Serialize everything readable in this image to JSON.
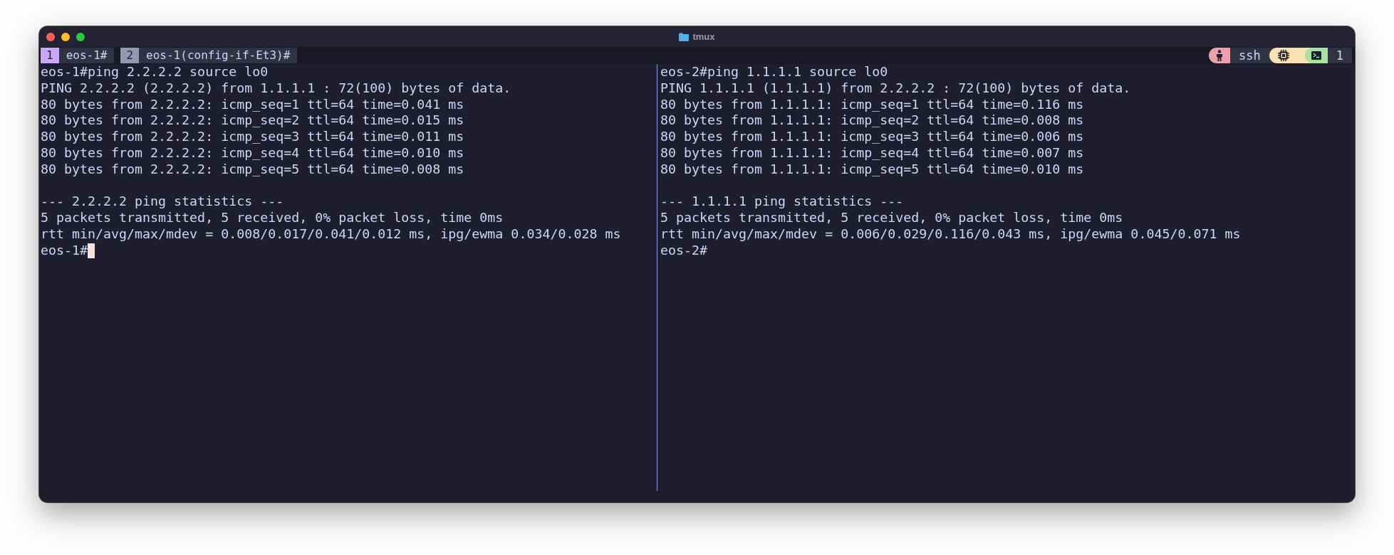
{
  "window": {
    "title": "tmux"
  },
  "tabs": [
    {
      "number": "1",
      "label": "eos-1#",
      "selected": true
    },
    {
      "number": "2",
      "label": "eos-1(config-if-Et3)#",
      "selected": false
    }
  ],
  "status_right": {
    "session": "ssh",
    "window_count": "1"
  },
  "panes": [
    {
      "active": true,
      "blocks": [
        [
          "eos-1#ping 2.2.2.2 source lo0",
          "PING 2.2.2.2 (2.2.2.2) from 1.1.1.1 : 72(100) bytes of data.",
          "80 bytes from 2.2.2.2: icmp_seq=1 ttl=64 time=0.041 ms",
          "80 bytes from 2.2.2.2: icmp_seq=2 ttl=64 time=0.015 ms",
          "80 bytes from 2.2.2.2: icmp_seq=3 ttl=64 time=0.011 ms",
          "80 bytes from 2.2.2.2: icmp_seq=4 ttl=64 time=0.010 ms",
          "80 bytes from 2.2.2.2: icmp_seq=5 ttl=64 time=0.008 ms"
        ],
        [
          "--- 2.2.2.2 ping statistics ---",
          "5 packets transmitted, 5 received, 0% packet loss, time 0ms",
          "rtt min/avg/max/mdev = 0.008/0.017/0.041/0.012 ms, ipg/ewma 0.034/0.028 ms",
          "eos-1#"
        ]
      ]
    },
    {
      "active": false,
      "blocks": [
        [
          "eos-2#ping 1.1.1.1 source lo0",
          "PING 1.1.1.1 (1.1.1.1) from 2.2.2.2 : 72(100) bytes of data.",
          "80 bytes from 1.1.1.1: icmp_seq=1 ttl=64 time=0.116 ms",
          "80 bytes from 1.1.1.1: icmp_seq=2 ttl=64 time=0.008 ms",
          "80 bytes from 1.1.1.1: icmp_seq=3 ttl=64 time=0.006 ms",
          "80 bytes from 1.1.1.1: icmp_seq=4 ttl=64 time=0.007 ms",
          "80 bytes from 1.1.1.1: icmp_seq=5 ttl=64 time=0.010 ms"
        ],
        [
          "--- 1.1.1.1 ping statistics ---",
          "5 packets transmitted, 5 received, 0% packet loss, time 0ms",
          "rtt min/avg/max/mdev = 0.006/0.029/0.116/0.043 ms, ipg/ewma 0.045/0.071 ms",
          "eos-2#"
        ]
      ]
    }
  ]
}
